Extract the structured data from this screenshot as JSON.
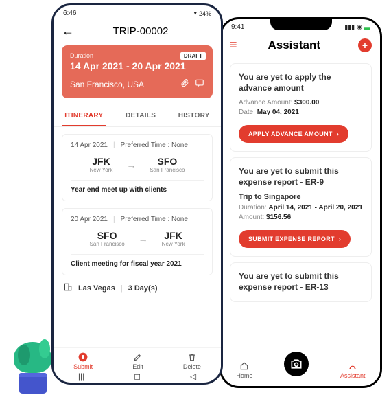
{
  "colors": {
    "accent": "#e23c2e",
    "heroBg": "#e56a58"
  },
  "left": {
    "status": {
      "time": "6:46",
      "battery": "24%"
    },
    "appbar": {
      "title": "TRIP-00002"
    },
    "hero": {
      "durationLabel": "Duration",
      "dates": "14 Apr 2021 - 20 Apr 2021",
      "statusBadge": "DRAFT",
      "location": "San Francisco, USA"
    },
    "tabs": [
      {
        "label": "ITINERARY",
        "active": true
      },
      {
        "label": "DETAILS",
        "active": false
      },
      {
        "label": "HISTORY",
        "active": false
      }
    ],
    "legs": [
      {
        "date": "14 Apr 2021",
        "preferred": "Preferred Time : None",
        "from": {
          "code": "JFK",
          "city": "New York"
        },
        "to": {
          "code": "SFO",
          "city": "San Francisco"
        },
        "note": "Year end meet up with clients"
      },
      {
        "date": "20 Apr 2021",
        "preferred": "Preferred Time : None",
        "from": {
          "code": "SFO",
          "city": "San Francisco"
        },
        "to": {
          "code": "JFK",
          "city": "New York"
        },
        "note": "Client meeting for fiscal year 2021"
      }
    ],
    "hotel": {
      "city": "Las Vegas",
      "nights": "3 Day(s)"
    },
    "bottom": [
      {
        "label": "Submit",
        "active": true,
        "icon": "submit-icon"
      },
      {
        "label": "Edit",
        "active": false,
        "icon": "edit-icon"
      },
      {
        "label": "Delete",
        "active": false,
        "icon": "delete-icon"
      }
    ]
  },
  "right": {
    "status": {
      "time": "9:41"
    },
    "header": {
      "title": "Assistant"
    },
    "cards": [
      {
        "heading": "You are yet to apply the advance amount",
        "rows": [
          {
            "label": "Advance Amount:",
            "value": "$300.00"
          },
          {
            "label": "Date:",
            "value": "May 04, 2021"
          }
        ],
        "cta": "APPLY ADVANCE AMOUNT"
      },
      {
        "heading": "You are yet to submit this expense report - ER-9",
        "subtitle": "Trip to Singapore",
        "rows": [
          {
            "label": "Duration:",
            "value": "April 14, 2021 - April 20, 2021"
          },
          {
            "label": "Amount:",
            "value": "$156.56"
          }
        ],
        "cta": "SUBMIT EXPENSE REPORT"
      },
      {
        "heading": "You are yet to submit this expense report - ER-13"
      }
    ],
    "bottom": {
      "home": "Home",
      "assistant": "Assistant"
    }
  }
}
